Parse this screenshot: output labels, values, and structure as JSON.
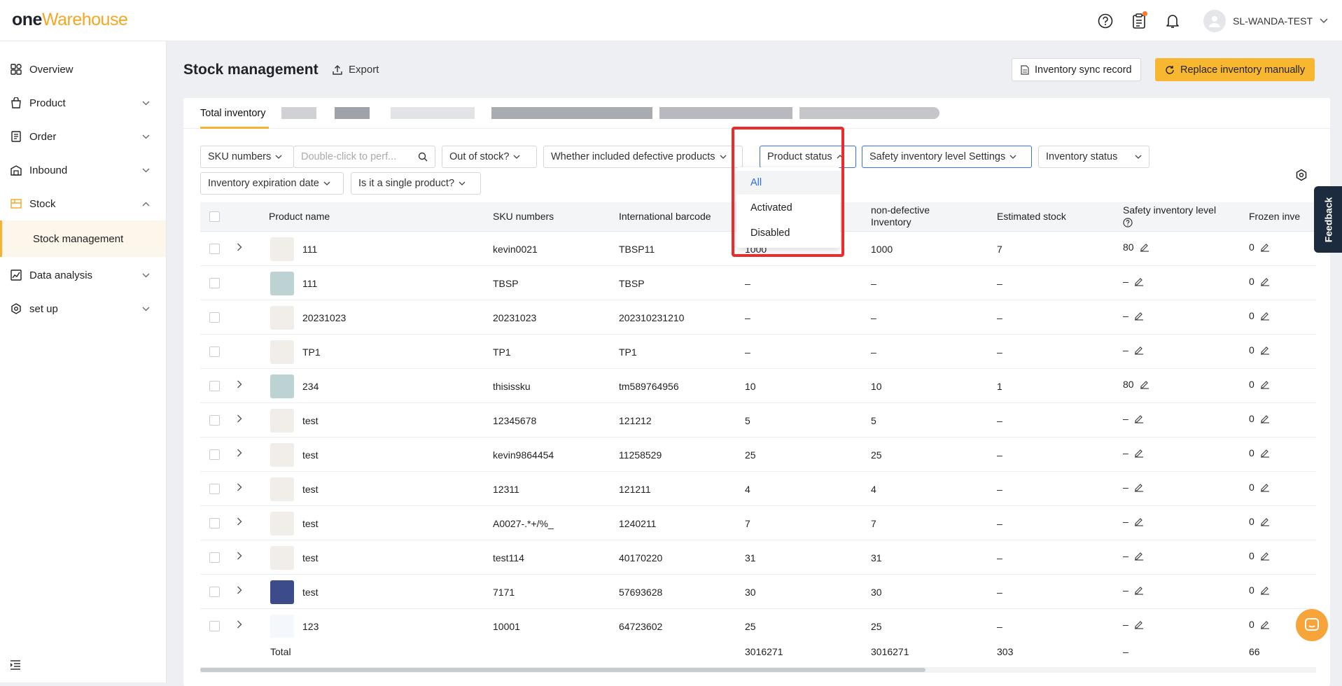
{
  "app": {
    "logo_one": "one",
    "logo_warehouse": "Warehouse",
    "user_name": "SL-WANDA-TEST"
  },
  "sidebar": {
    "items": [
      {
        "label": "Overview"
      },
      {
        "label": "Product"
      },
      {
        "label": "Order"
      },
      {
        "label": "Inbound"
      },
      {
        "label": "Stock"
      },
      {
        "label": "Stock management"
      },
      {
        "label": "Data analysis"
      },
      {
        "label": "set up"
      }
    ]
  },
  "header": {
    "title": "Stock management",
    "export": "Export",
    "sync_record": "Inventory sync record",
    "replace_manually": "Replace inventory manually"
  },
  "tabs": {
    "active": "Total inventory"
  },
  "filters": {
    "sku": "SKU numbers",
    "sku_placeholder": "Double-click to perf...",
    "out_of_stock": "Out of stock?",
    "defective": "Whether included defective products",
    "product_status": "Product status",
    "safety": "Safety inventory level Settings",
    "inventory_status": "Inventory status",
    "expiration": "Inventory expiration date",
    "single": "Is it a single product?"
  },
  "dropdown": {
    "options": [
      "All",
      "Activated",
      "Disabled"
    ],
    "selected": "All"
  },
  "columns": {
    "product_name": "Product name",
    "sku": "SKU numbers",
    "barcode": "International barcode",
    "nondef1": "non-defective",
    "nondef2": "inventory",
    "estimated": "Estimated stock",
    "safety": "Safety inventory level",
    "frozen": "Frozen inve"
  },
  "rows": [
    {
      "name": "111",
      "sku": "kevin0021",
      "barcode": "TBSP11",
      "stock": "1000",
      "nondef": "1000",
      "est": "7",
      "safety": "80",
      "frozen": "0",
      "expand": true
    },
    {
      "name": "111",
      "sku": "TBSP",
      "barcode": "TBSP",
      "stock": "–",
      "nondef": "–",
      "est": "–",
      "safety": "–",
      "frozen": "0",
      "expand": false
    },
    {
      "name": "20231023",
      "sku": "20231023",
      "barcode": "202310231210",
      "stock": "–",
      "nondef": "–",
      "est": "–",
      "safety": "–",
      "frozen": "0",
      "expand": false
    },
    {
      "name": "TP1",
      "sku": "TP1",
      "barcode": "TP1",
      "stock": "–",
      "nondef": "–",
      "est": "–",
      "safety": "–",
      "frozen": "0",
      "expand": false
    },
    {
      "name": "234",
      "sku": "thisissku",
      "barcode": "tm589764956",
      "stock": "10",
      "nondef": "10",
      "est": "1",
      "safety": "80",
      "frozen": "0",
      "expand": true
    },
    {
      "name": "test",
      "sku": "12345678",
      "barcode": "121212",
      "stock": "5",
      "nondef": "5",
      "est": "–",
      "safety": "–",
      "frozen": "0",
      "expand": true
    },
    {
      "name": "test",
      "sku": "kevin9864454",
      "barcode": "11258529",
      "stock": "25",
      "nondef": "25",
      "est": "–",
      "safety": "–",
      "frozen": "0",
      "expand": true
    },
    {
      "name": "test",
      "sku": "12311",
      "barcode": "121211",
      "stock": "4",
      "nondef": "4",
      "est": "–",
      "safety": "–",
      "frozen": "0",
      "expand": true
    },
    {
      "name": "test",
      "sku": "A0027-.*+/%_",
      "barcode": "1240211",
      "stock": "7",
      "nondef": "7",
      "est": "–",
      "safety": "–",
      "frozen": "0",
      "expand": true
    },
    {
      "name": "test",
      "sku": "test114",
      "barcode": "40170220",
      "stock": "31",
      "nondef": "31",
      "est": "–",
      "safety": "–",
      "frozen": "0",
      "expand": true
    },
    {
      "name": "test",
      "sku": "7171",
      "barcode": "57693628",
      "stock": "30",
      "nondef": "30",
      "est": "–",
      "safety": "–",
      "frozen": "0",
      "expand": true
    },
    {
      "name": "123",
      "sku": "10001",
      "barcode": "64723602",
      "stock": "25",
      "nondef": "25",
      "est": "–",
      "safety": "–",
      "frozen": "0",
      "expand": true
    }
  ],
  "totals": {
    "label": "Total",
    "stock": "3016271",
    "nondef": "3016271",
    "est": "303",
    "safety": "–",
    "frozen": "66"
  },
  "feedback": "Feedback"
}
